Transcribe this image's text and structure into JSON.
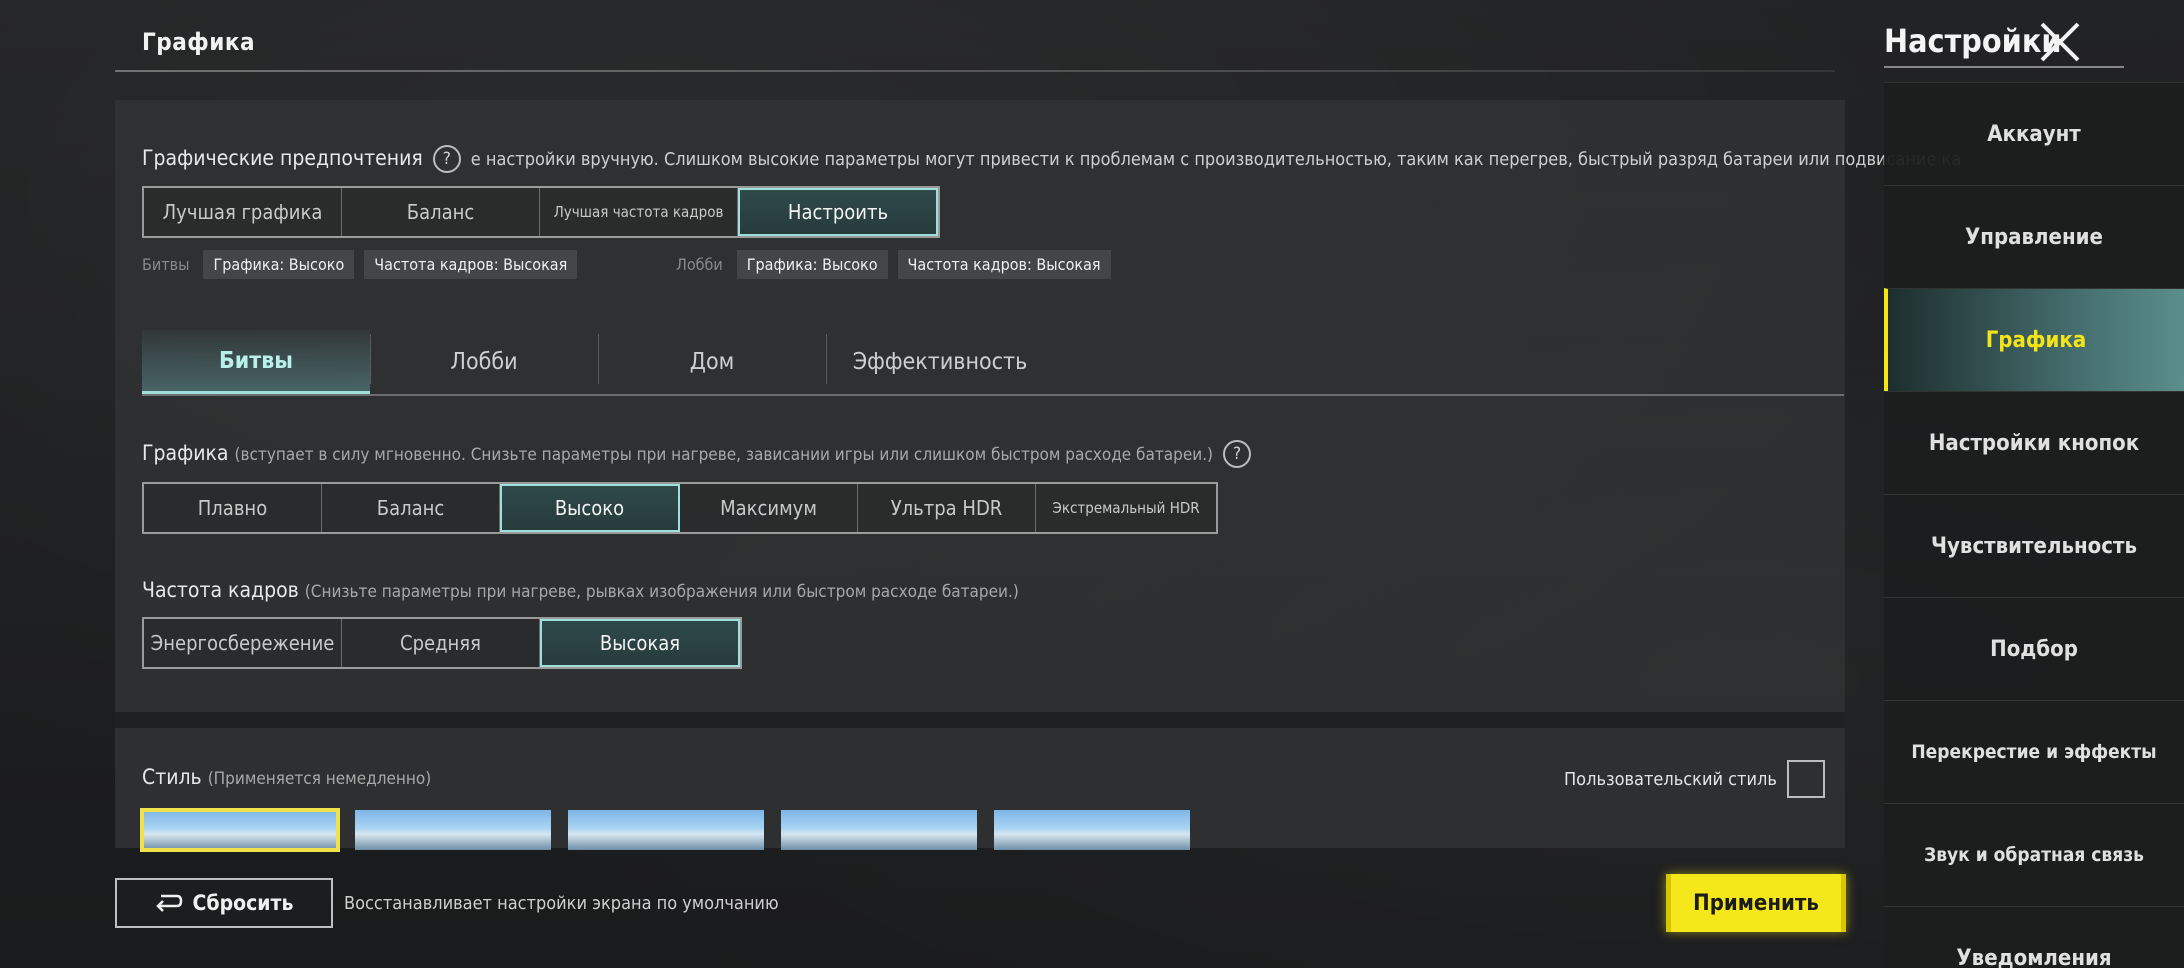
{
  "header": {
    "section_title": "Графика",
    "settings_title": "Настройки"
  },
  "prefs": {
    "title": "Графические предпочтения",
    "help_glyph": "?",
    "description": "е настройки вручную. Слишком высокие параметры могут привести к проблемам с производительностью, таким как перегрев, быстрый разряд батареи или подвисание ка",
    "options": [
      "Лучшая графика",
      "Баланс",
      "Лучшая частота кадров",
      "Настроить"
    ],
    "selected_index": 3,
    "battles_label": "Битвы",
    "battles_chips": [
      "Графика: Высоко",
      "Частота кадров: Высокая"
    ],
    "lobby_label": "Лобби",
    "lobby_chips": [
      "Графика: Высоко",
      "Частота кадров: Высокая"
    ]
  },
  "tabs": [
    "Битвы",
    "Лобби",
    "Дом",
    "Эффективность"
  ],
  "active_tab_index": 0,
  "graphics": {
    "title": "Графика",
    "hint": "(вступает в силу мгновенно. Снизьте параметры при нагреве, зависании игры или слишком быстром расходе батареи.)",
    "help_glyph": "?",
    "options": [
      "Плавно",
      "Баланс",
      "Высоко",
      "Максимум",
      "Ультра HDR",
      "Экстремальный HDR"
    ],
    "selected_index": 2
  },
  "framerate": {
    "title": "Частота кадров",
    "hint": "(Снизьте параметры при нагреве, рывках изображения или быстром расходе батареи.)",
    "options": [
      "Энергосбережение",
      "Средняя",
      "Высокая"
    ],
    "selected_index": 2
  },
  "style": {
    "title": "Стиль",
    "hint": "(Применяется немедленно)",
    "custom_style_label": "Пользовательский стиль",
    "custom_style_checked": false,
    "thumbnails_count": 5,
    "selected_index": 0
  },
  "footer": {
    "reset_label": "Сбросить",
    "reset_description": "Восстанавливает настройки экрана по умолчанию",
    "apply_label": "Применить"
  },
  "sidebar": {
    "items": [
      {
        "label": "Аккаунт"
      },
      {
        "label": "Управление"
      },
      {
        "label": "Графика"
      },
      {
        "label": "Настройки кнопок"
      },
      {
        "label": "Чувствительность"
      },
      {
        "label": "Подбор"
      },
      {
        "label": "Перекрестие и эффекты"
      },
      {
        "label": "Звук и обратная связь"
      },
      {
        "label": "Уведомления"
      }
    ],
    "active_index": 2
  },
  "colors": {
    "accent_teal": "#9fe0dc",
    "accent_yellow": "#f4e81a"
  }
}
